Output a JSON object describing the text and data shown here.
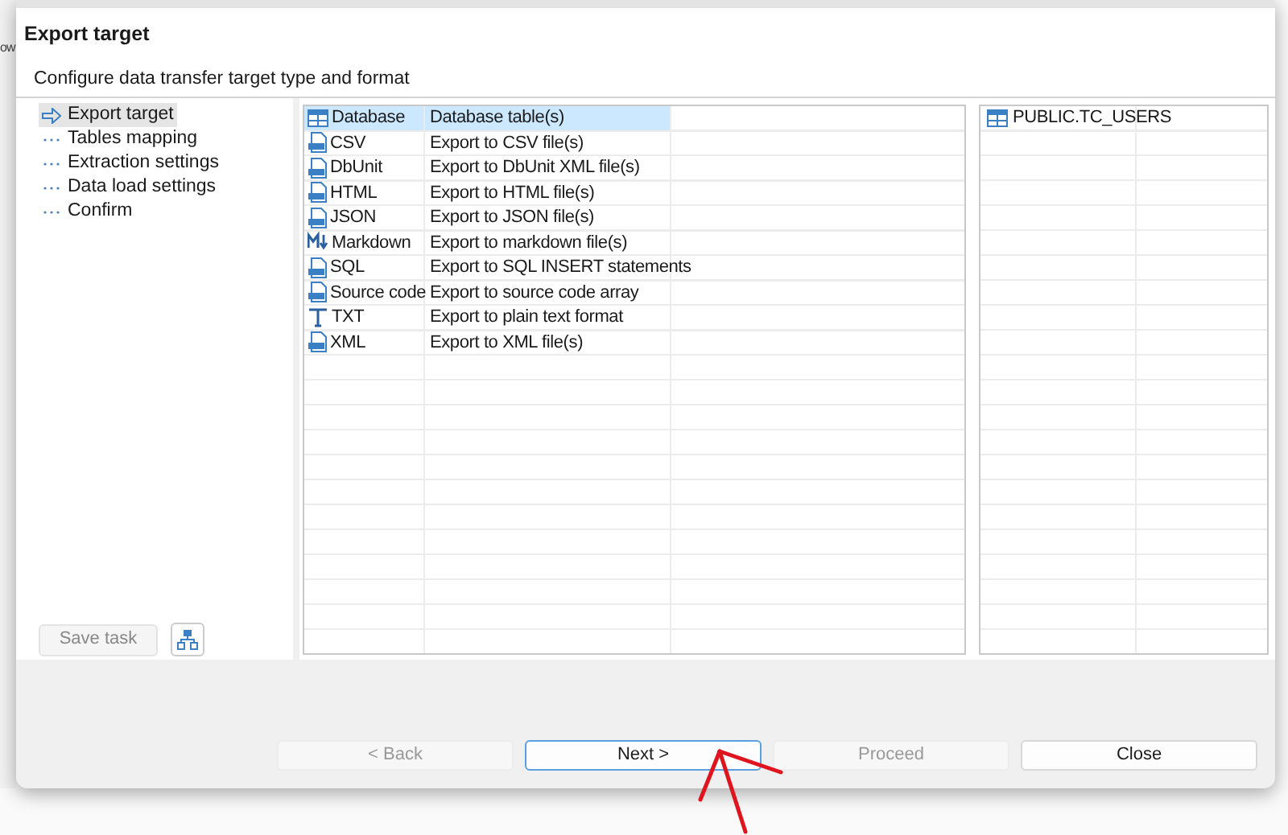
{
  "background": {
    "fragment": "ow"
  },
  "header": {
    "title": "Export target",
    "description": "Configure data transfer target type and format"
  },
  "steps": [
    {
      "label": "Export target",
      "selected": true
    },
    {
      "label": "Tables mapping",
      "selected": false
    },
    {
      "label": "Extraction settings",
      "selected": false
    },
    {
      "label": "Data load settings",
      "selected": false
    },
    {
      "label": "Confirm",
      "selected": false
    }
  ],
  "save_task": {
    "label": "Save task",
    "disabled": true
  },
  "formats": [
    {
      "name": "Database",
      "description": "Database table(s)",
      "kind": "table",
      "selected": true
    },
    {
      "name": "CSV",
      "description": "Export to CSV file(s)",
      "kind": "file",
      "selected": false
    },
    {
      "name": "DbUnit",
      "description": "Export to DbUnit XML file(s)",
      "kind": "file",
      "selected": false
    },
    {
      "name": "HTML",
      "description": "Export to HTML file(s)",
      "kind": "file",
      "selected": false
    },
    {
      "name": "JSON",
      "description": "Export to JSON file(s)",
      "kind": "file",
      "selected": false
    },
    {
      "name": "Markdown",
      "description": "Export to markdown file(s)",
      "kind": "markdown",
      "selected": false
    },
    {
      "name": "SQL",
      "description": "Export to SQL INSERT statements",
      "kind": "file",
      "selected": false
    },
    {
      "name": "Source code",
      "description": "Export to source code array",
      "kind": "file",
      "selected": false
    },
    {
      "name": "TXT",
      "description": "Export to plain text format",
      "kind": "text",
      "selected": false
    },
    {
      "name": "XML",
      "description": "Export to XML file(s)",
      "kind": "file",
      "selected": false
    }
  ],
  "tables": [
    {
      "name": "PUBLIC.TC_USERS"
    }
  ],
  "buttons": [
    {
      "label": "< Back",
      "disabled": true,
      "default": false
    },
    {
      "label": "Next >",
      "disabled": false,
      "default": true
    },
    {
      "label": "Proceed",
      "disabled": true,
      "default": false
    },
    {
      "label": "Close",
      "disabled": false,
      "default": false
    }
  ]
}
